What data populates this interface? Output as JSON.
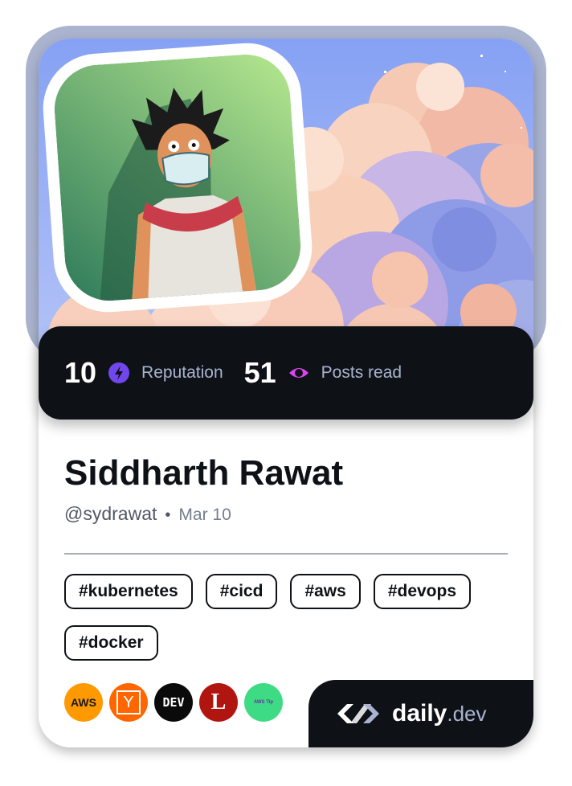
{
  "stats": {
    "reputation_value": "10",
    "reputation_label": "Reputation",
    "posts_value": "51",
    "posts_label": "Posts read"
  },
  "profile": {
    "name": "Siddharth Rawat",
    "handle": "@sydrawat",
    "separator": "•",
    "joined": "Mar 10"
  },
  "tags": [
    "#kubernetes",
    "#cicd",
    "#aws",
    "#devops",
    "#docker"
  ],
  "sources": [
    {
      "name": "aws-source-icon",
      "text": "AWS",
      "bg": "#ff9900",
      "fg": "#1a1a1a"
    },
    {
      "name": "hacker-news-source-icon",
      "text": "Y",
      "bg": "#ff6600",
      "fg": "#ffffff"
    },
    {
      "name": "dev-to-source-icon",
      "text": "DEV",
      "bg": "#0a0a0a",
      "fg": "#ffffff"
    },
    {
      "name": "l-source-icon",
      "text": "L",
      "bg": "#b0160f",
      "fg": "#ffffff"
    },
    {
      "name": "aws-tip-source-icon",
      "text": "AWS Tip",
      "bg": "#3ddc84",
      "fg": "#6f2ca8"
    }
  ],
  "brand": {
    "name": "daily",
    "tld": ".dev"
  },
  "colors": {
    "dark": "#0e1217",
    "reputation_accent": "#7147ed",
    "posts_accent": "#d946ef",
    "frame": "#aab4cf",
    "sky": "#8ea7f3"
  }
}
